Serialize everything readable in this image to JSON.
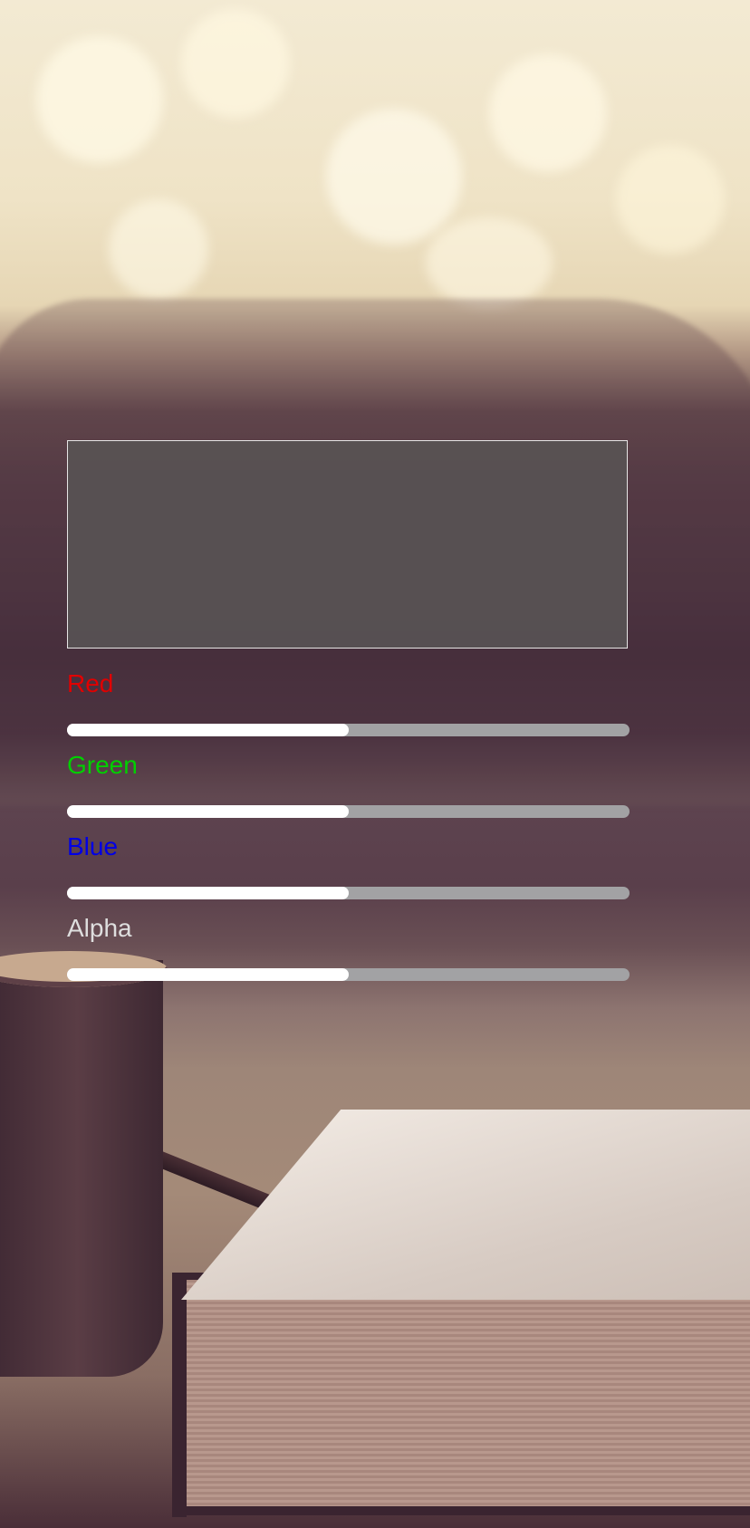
{
  "colors": {
    "red_label": "#e10000",
    "green_label": "#00d000",
    "blue_label": "#0000e6",
    "alpha_label": "#dedede",
    "slider_fill": "#ffffff",
    "slider_track": "#a2a2a4",
    "preview_color": "#585254"
  },
  "preview": {
    "name": "color-preview"
  },
  "sliders": [
    {
      "label": "Red",
      "value": 0.5
    },
    {
      "label": "Green",
      "value": 0.5
    },
    {
      "label": "Blue",
      "value": 0.5
    },
    {
      "label": "Alpha",
      "value": 0.5
    }
  ]
}
